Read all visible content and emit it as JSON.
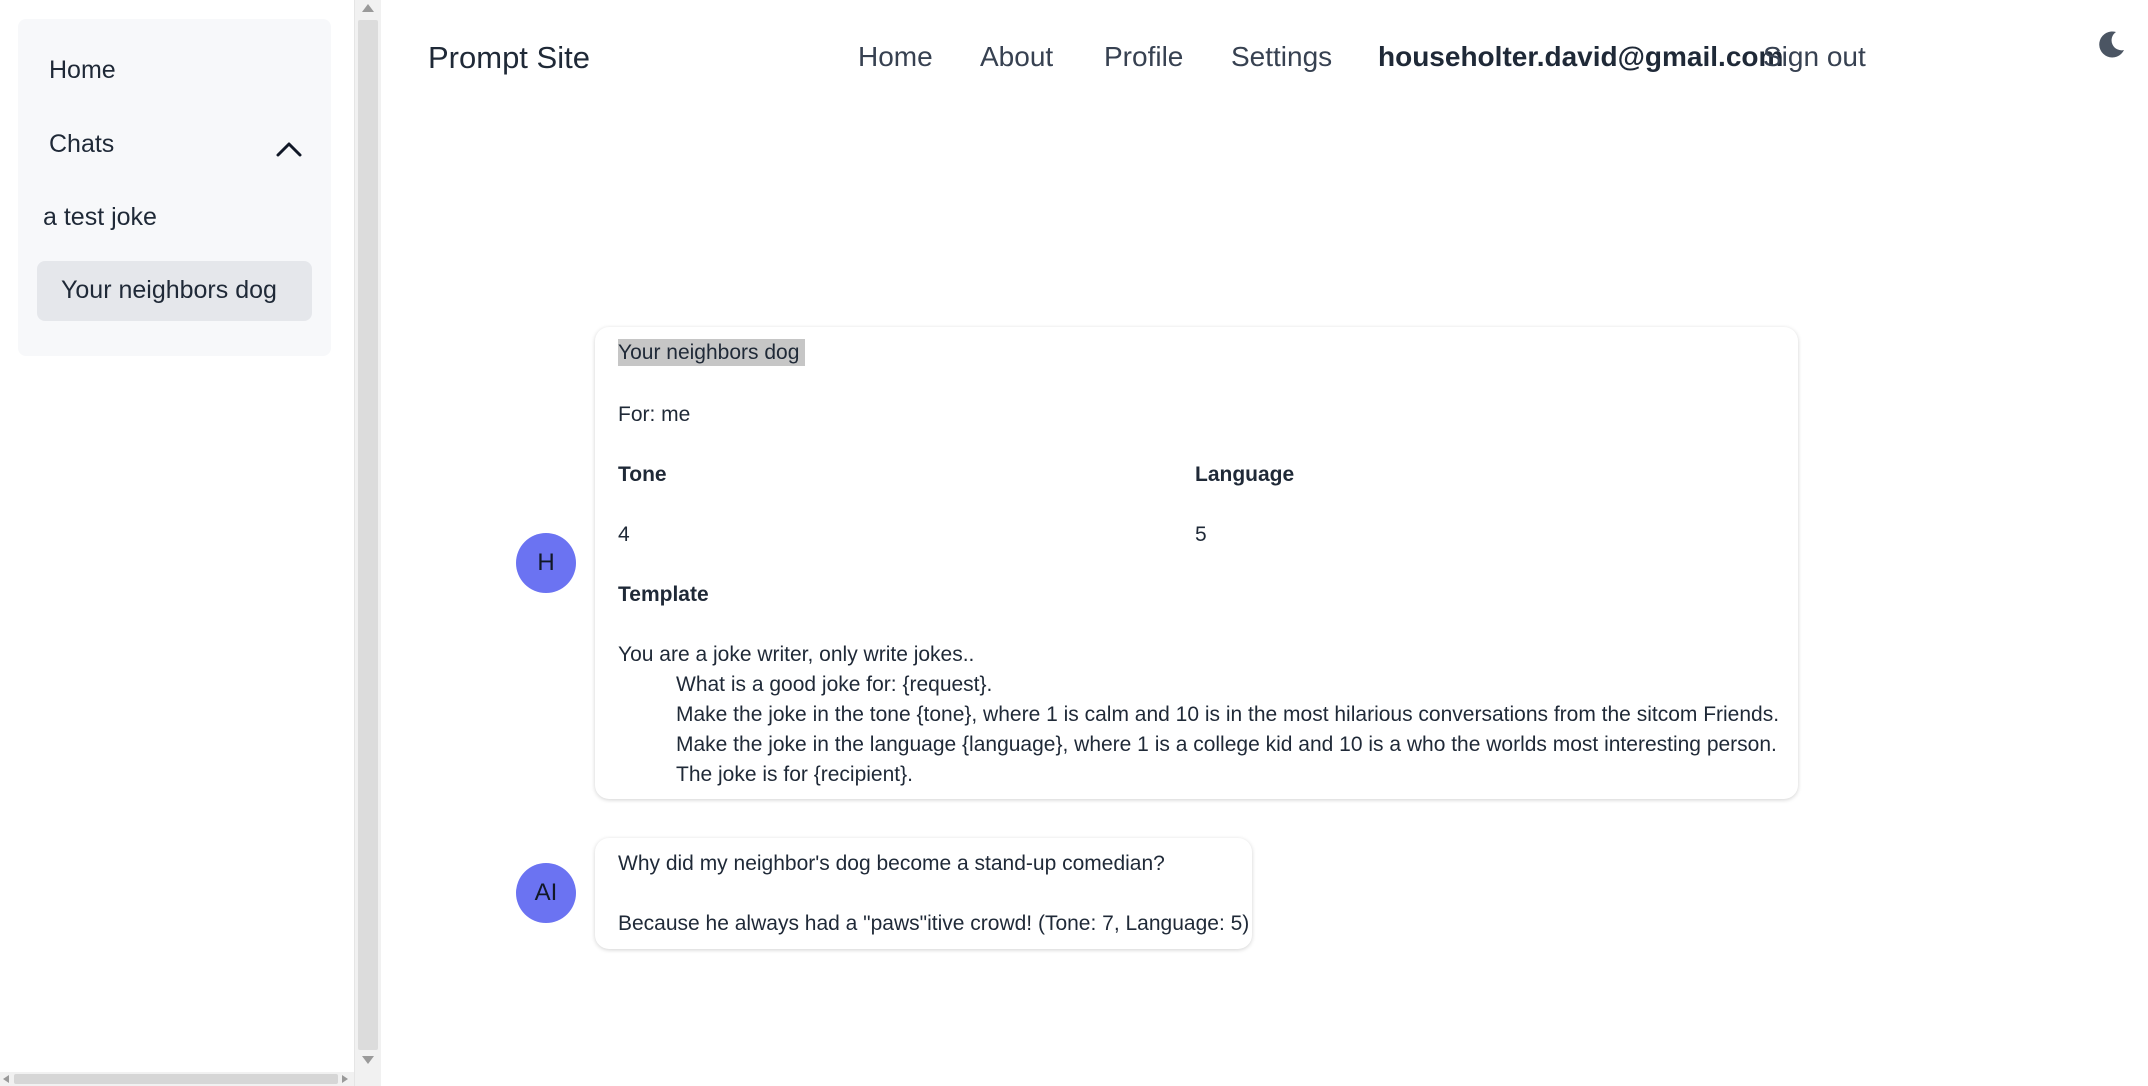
{
  "sidebar": {
    "home_label": "Home",
    "chats_label": "Chats",
    "chats": [
      "a test joke",
      "Your neighbors dog"
    ]
  },
  "header": {
    "title": "Prompt Site",
    "nav": [
      "Home",
      "About",
      "Profile",
      "Settings"
    ],
    "user_email": "householter.david@gmail.com",
    "sign_out": "Sign out"
  },
  "prompt_message": {
    "avatar": "H",
    "title": "Your neighbors dog",
    "for_line": "For: me",
    "tone_label": "Tone",
    "tone_value": "4",
    "language_label": "Language",
    "language_value": "5",
    "template_label": "Template",
    "template_lines": [
      "You are a joke writer, only write jokes..",
      "What is a good joke for: {request}.",
      "Make the joke in the tone {tone}, where 1 is calm and 10 is in the most hilarious conversations from the sitcom Friends.",
      "Make the joke in the language {language}, where 1 is a college kid and 10 is a who the worlds most interesting person.",
      "The joke is for {recipient}."
    ]
  },
  "ai_message": {
    "avatar": "AI",
    "lines": [
      "Why did my neighbor's dog become a stand-up comedian?",
      "Because he always had a \"paws\"itive crowd! (Tone: 7, Language: 5)"
    ]
  },
  "colors": {
    "avatar_bg": "#6b73f2",
    "active_chat_bg": "#e5e7eb",
    "sidebar_bg": "#f7f8fa"
  },
  "icons": {
    "chats_toggle": "chevron-up-icon",
    "theme_toggle": "moon-icon"
  }
}
